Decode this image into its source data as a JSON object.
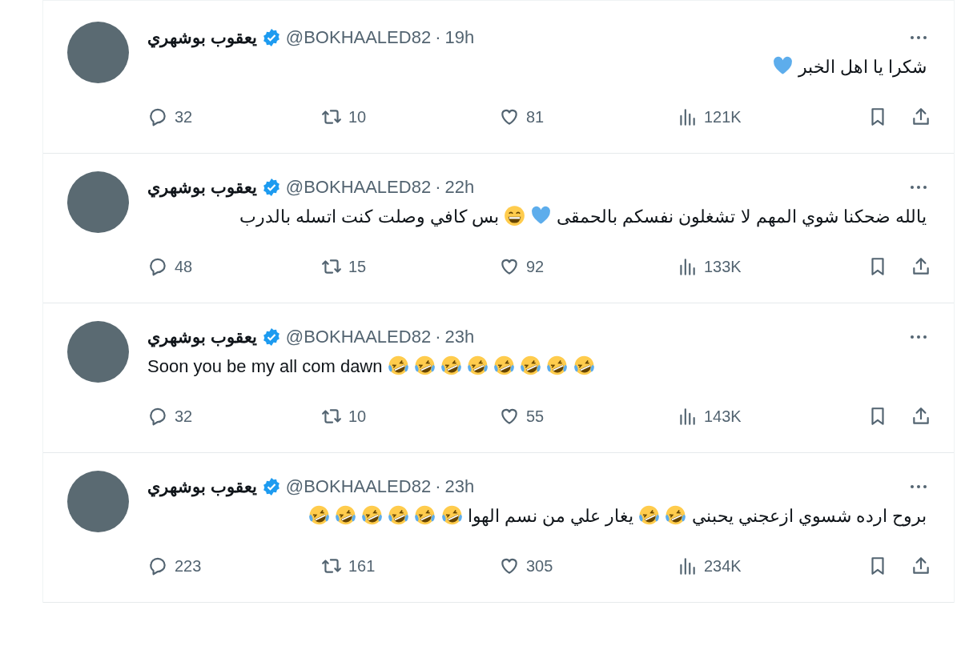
{
  "tweets": [
    {
      "name": "يعقوب بوشهري",
      "verified": true,
      "handle": "@BOKHAALED82",
      "separator": "·",
      "time": "19h",
      "body": [
        {
          "kind": "text",
          "text": "شكرا يا اهل الخبر"
        },
        {
          "kind": "heart"
        }
      ],
      "stats": {
        "replies": "32",
        "reposts": "10",
        "likes": "81",
        "views": "121K"
      }
    },
    {
      "name": "يعقوب بوشهري",
      "verified": true,
      "handle": "@BOKHAALED82",
      "separator": "·",
      "time": "22h",
      "body": [
        {
          "kind": "text",
          "text": "يالله ضحكنا شوي المهم لا تشغلون نفسكم بالحمقى"
        },
        {
          "kind": "heart"
        },
        {
          "kind": "grin"
        },
        {
          "kind": "text",
          "text": "بس كافي وصلت كنت اتسله  بالدرب"
        }
      ],
      "stats": {
        "replies": "48",
        "reposts": "15",
        "likes": "92",
        "views": "133K"
      }
    },
    {
      "name": "يعقوب بوشهري",
      "verified": true,
      "handle": "@BOKHAALED82",
      "separator": "·",
      "time": "23h",
      "body": [
        {
          "kind": "text",
          "text": "Soon you be my all com dawn"
        },
        {
          "kind": "laugh"
        },
        {
          "kind": "laugh"
        },
        {
          "kind": "laugh"
        },
        {
          "kind": "laugh"
        },
        {
          "kind": "laugh"
        },
        {
          "kind": "laugh"
        },
        {
          "kind": "laugh"
        },
        {
          "kind": "laugh"
        }
      ],
      "stats": {
        "replies": "32",
        "reposts": "10",
        "likes": "55",
        "views": "143K"
      }
    },
    {
      "name": "يعقوب بوشهري",
      "verified": true,
      "handle": "@BOKHAALED82",
      "separator": "·",
      "time": "23h",
      "body": [
        {
          "kind": "text",
          "text": "بروح ارده شسوي ازعجني يحبني"
        },
        {
          "kind": "laugh"
        },
        {
          "kind": "laugh"
        },
        {
          "kind": "text",
          "text": "يغار علي من نسم الهوا"
        },
        {
          "kind": "laugh"
        },
        {
          "kind": "laugh"
        },
        {
          "kind": "laugh"
        },
        {
          "kind": "laugh"
        },
        {
          "kind": "laugh"
        },
        {
          "kind": "laugh"
        }
      ],
      "stats": {
        "replies": "223",
        "reposts": "161",
        "likes": "305",
        "views": "234K"
      }
    }
  ]
}
